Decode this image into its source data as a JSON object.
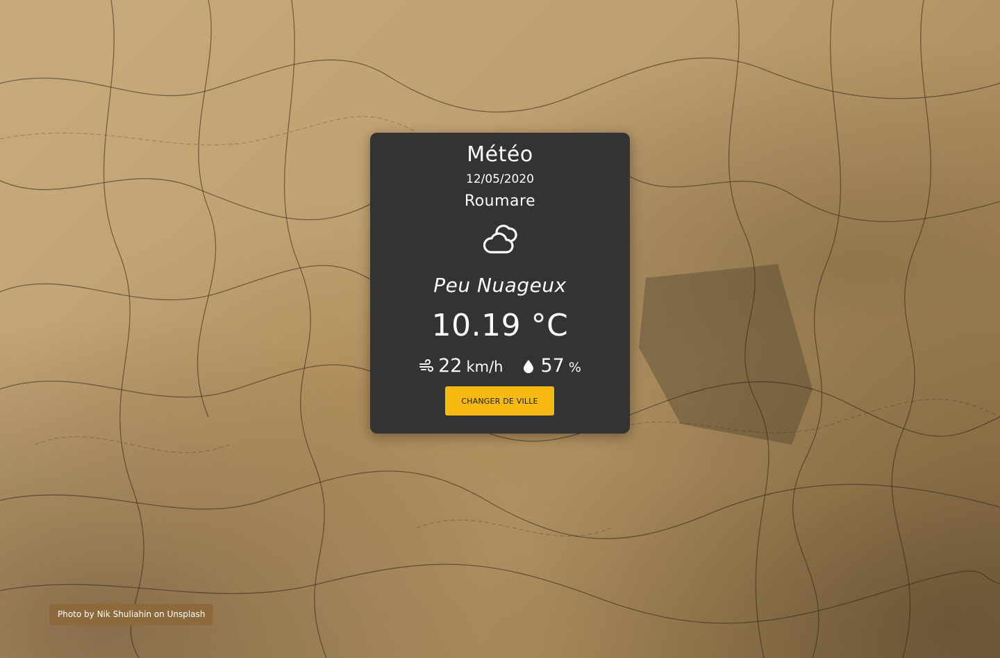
{
  "card": {
    "title": "Météo",
    "date": "12/05/2020",
    "city": "Roumare",
    "weather_icon": "partly-cloudy-icon",
    "condition": "Peu Nuageux",
    "temperature": "10.19 °C",
    "wind": {
      "icon": "wind-icon",
      "value": "22",
      "unit": "km/h"
    },
    "humidity": {
      "icon": "humidity-drop-icon",
      "value": "57",
      "unit": "%"
    },
    "change_city_label": "CHANGER DE VILLE"
  },
  "credit": {
    "prefix": "Photo by ",
    "author": "Nik Shuliahin",
    "middle": " on ",
    "source": "Unsplash"
  },
  "colors": {
    "card_bg": "#333333",
    "button_bg": "#f5b90f",
    "credit_bg": "#8c6a3c",
    "text": "#ffffff"
  }
}
